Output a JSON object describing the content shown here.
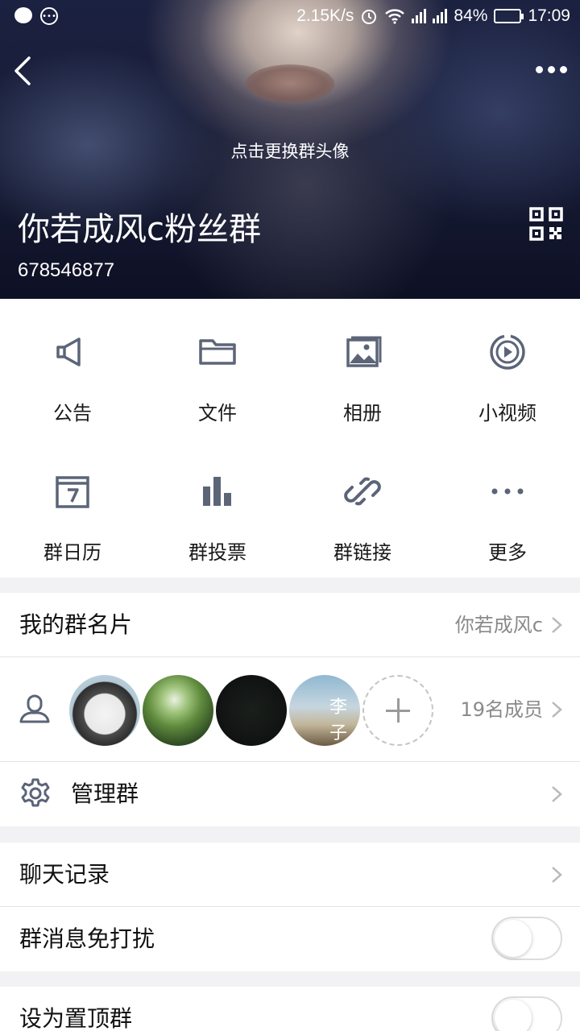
{
  "status_bar": {
    "speed": "2.15K/s",
    "battery_percent": "84%",
    "battery_level": 0.84,
    "time": "17:09"
  },
  "header": {
    "change_avatar_hint": "点击更换群头像",
    "group_name": "你若成风c粉丝群",
    "group_id": "678546877"
  },
  "features": [
    {
      "label": "公告",
      "icon": "megaphone-icon"
    },
    {
      "label": "文件",
      "icon": "folder-icon"
    },
    {
      "label": "相册",
      "icon": "album-icon"
    },
    {
      "label": "小视频",
      "icon": "video-icon"
    },
    {
      "label": "群日历",
      "icon": "calendar-icon"
    },
    {
      "label": "群投票",
      "icon": "bar-chart-icon"
    },
    {
      "label": "群链接",
      "icon": "link-icon"
    },
    {
      "label": "更多",
      "icon": "more-dots-icon"
    }
  ],
  "my_card": {
    "title": "我的群名片",
    "value": "你若成风c"
  },
  "members": {
    "count_label": "19名成员",
    "avatar_text": "李子"
  },
  "manage": {
    "title": "管理群"
  },
  "settings": {
    "chat_history": "聊天记录",
    "mute": "群消息免打扰",
    "pin": "设为置顶群"
  },
  "colors": {
    "icon_gray": "#5c6478",
    "battery_green": "#35d43a"
  }
}
